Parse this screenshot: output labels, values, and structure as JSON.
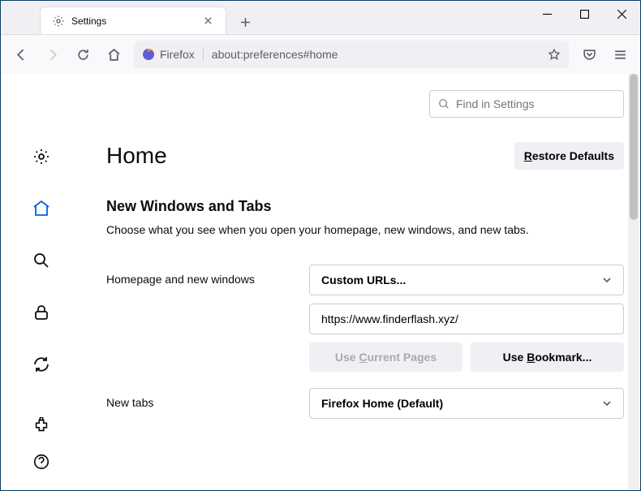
{
  "tab": {
    "title": "Settings"
  },
  "url": {
    "identity": "Firefox",
    "value": "about:preferences#home"
  },
  "search": {
    "placeholder": "Find in Settings"
  },
  "page": {
    "title": "Home",
    "restore": "Restore Defaults",
    "section_title": "New Windows and Tabs",
    "section_desc": "Choose what you see when you open your homepage, new windows, and new tabs."
  },
  "homepage": {
    "label": "Homepage and new windows",
    "select": "Custom URLs...",
    "url": "https://www.finderflash.xyz/",
    "use_current": "Use Current Pages",
    "use_bookmark": "Use Bookmark..."
  },
  "newtabs": {
    "label": "New tabs",
    "select": "Firefox Home (Default)"
  }
}
